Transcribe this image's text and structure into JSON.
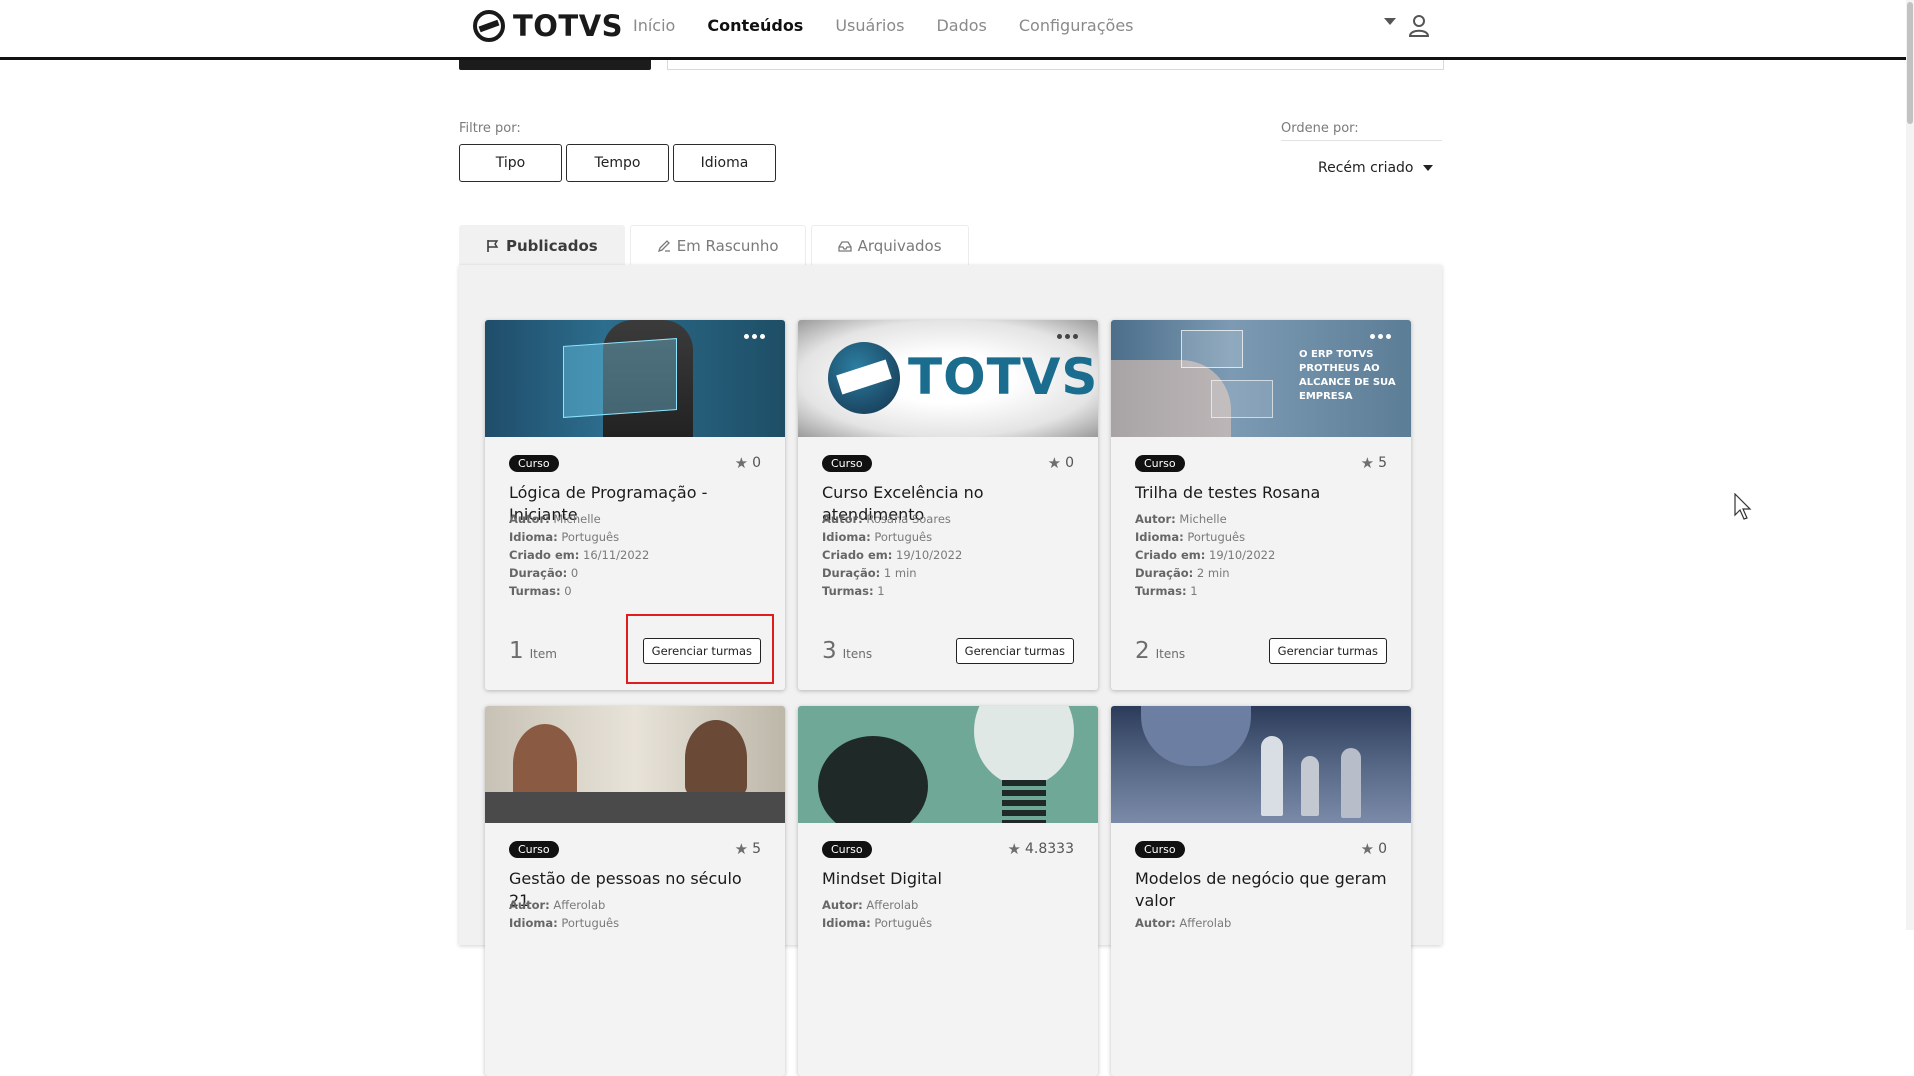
{
  "header": {
    "logo_text": "TOTVS",
    "nav": [
      "Início",
      "Conteúdos",
      "Usuários",
      "Dados",
      "Configurações"
    ],
    "active_nav": "Conteúdos"
  },
  "filters": {
    "label": "Filtre por:",
    "buttons": [
      "Tipo",
      "Tempo",
      "Idioma"
    ]
  },
  "order": {
    "label": "Ordene por:",
    "selected": "Recém criado"
  },
  "tabs": [
    "Publicados",
    "Em Rascunho",
    "Arquivados"
  ],
  "labels": {
    "autor": "Autor:",
    "idioma": "Idioma:",
    "criado": "Criado em:",
    "duracao": "Duração:",
    "turmas": "Turmas:",
    "manage": "Gerenciar turmas"
  },
  "cards": [
    {
      "badge": "Curso",
      "rating": "0",
      "title": "Lógica de Programação - Iniciante",
      "autor": "Michelle",
      "idioma": "Português",
      "criado": "16/11/2022",
      "duracao": "0",
      "turmas": "0",
      "count": "1",
      "unit": "Item"
    },
    {
      "badge": "Curso",
      "rating": "0",
      "title": "Curso Excelência no atendimento",
      "autor": "Rosana Soares",
      "idioma": "Português",
      "criado": "19/10/2022",
      "duracao": "1 min",
      "turmas": "1",
      "count": "3",
      "unit": "Itens",
      "image_text": "TOTVS"
    },
    {
      "badge": "Curso",
      "rating": "5",
      "title": "Trilha de testes Rosana",
      "autor": "Michelle",
      "idioma": "Português",
      "criado": "19/10/2022",
      "duracao": "2 min",
      "turmas": "1",
      "count": "2",
      "unit": "Itens",
      "image_text": "O ERP TOTVS PROTHEUS AO ALCANCE DE SUA EMPRESA"
    },
    {
      "badge": "Curso",
      "rating": "5",
      "title": "Gestão de pessoas no século 21",
      "autor": "Afferolab",
      "idioma": "Português"
    },
    {
      "badge": "Curso",
      "rating": "4.8333",
      "title": "Mindset Digital",
      "autor": "Afferolab",
      "idioma": "Português"
    },
    {
      "badge": "Curso",
      "rating": "0",
      "title": "Modelos de negócio que geram valor",
      "autor": "Afferolab"
    }
  ],
  "icons": {
    "menu": "more-dots-icon",
    "star": "star-icon",
    "user": "user-icon",
    "caret": "chevron-down-icon",
    "flag": "flag-icon",
    "draft": "edit-icon",
    "archive": "archive-icon"
  }
}
